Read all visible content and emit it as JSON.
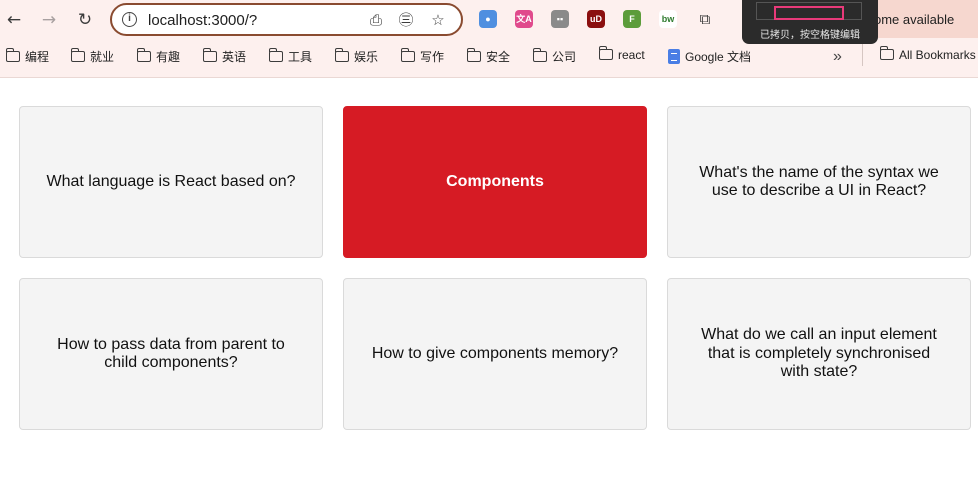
{
  "browser": {
    "url": "localhost:3000/?",
    "update_notice": "ome available",
    "tooltip_text": "已拷贝，按空格键编辑",
    "extensions": [
      {
        "name": "colorful-circle-extension",
        "color": "#4f8fe0",
        "glyph": "●"
      },
      {
        "name": "translate-extension",
        "color": "#e04a8c",
        "glyph": "文A"
      },
      {
        "name": "tabs-extension",
        "color": "#8a8a8a",
        "glyph": "▪▪"
      },
      {
        "name": "ublock-extension",
        "color": "#8b0f0f",
        "glyph": "uD"
      },
      {
        "name": "green-extension",
        "color": "#5c9c3a",
        "glyph": "F"
      },
      {
        "name": "bw-extension",
        "color": "#ffffff",
        "glyph": "bw"
      }
    ]
  },
  "bookmarks": [
    {
      "label": "编程",
      "type": "folder"
    },
    {
      "label": "就业",
      "type": "folder"
    },
    {
      "label": "有趣",
      "type": "folder"
    },
    {
      "label": "英语",
      "type": "folder"
    },
    {
      "label": "工具",
      "type": "folder"
    },
    {
      "label": "娱乐",
      "type": "folder"
    },
    {
      "label": "写作",
      "type": "folder"
    },
    {
      "label": "安全",
      "type": "folder"
    },
    {
      "label": "公司",
      "type": "folder"
    },
    {
      "label": "react",
      "type": "folder"
    },
    {
      "label": "Google 文档",
      "type": "doc"
    }
  ],
  "bookmarks_more": "»",
  "all_bookmarks": "All Bookmarks",
  "cards": [
    {
      "text": "What language is React based on?",
      "active": false
    },
    {
      "text": "Components",
      "active": true
    },
    {
      "text": "What's the name of the syntax we use to describe a UI in React?",
      "active": false
    },
    {
      "text": "How to pass data from parent to child components?",
      "active": false
    },
    {
      "text": "How to give components memory?",
      "active": false
    },
    {
      "text": "What do we call an input element that is completely synchronised with state?",
      "active": false
    }
  ],
  "colors": {
    "active_card": "#d61b24",
    "card_bg": "#f4f4f4",
    "chrome_bg": "#fdf0ee"
  }
}
